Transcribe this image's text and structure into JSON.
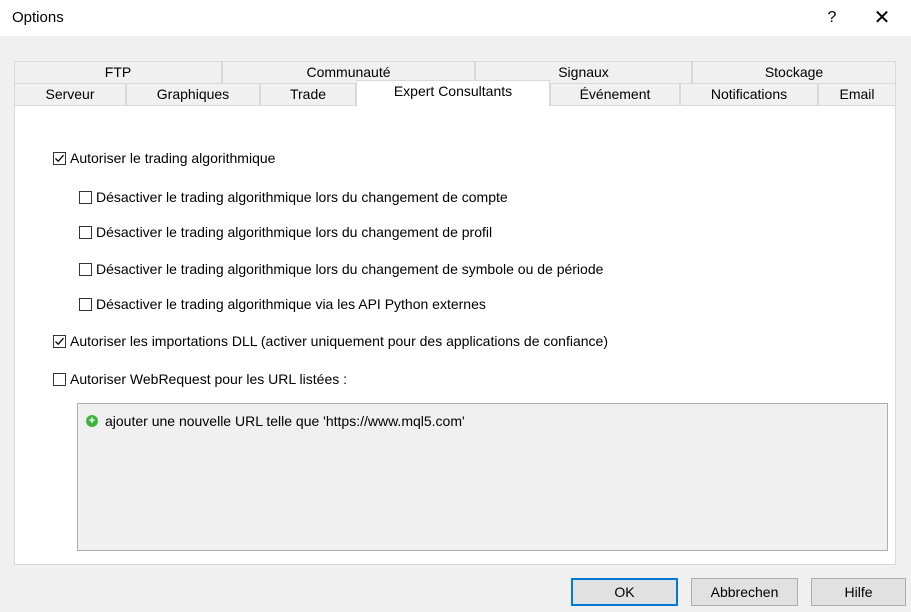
{
  "window": {
    "title": "Options",
    "help": "?",
    "close": "✕"
  },
  "tabs_back": [
    "FTP",
    "Communauté",
    "Signaux",
    "Stockage"
  ],
  "tabs_front": [
    "Serveur",
    "Graphiques",
    "Trade",
    "Expert Consultants",
    "Événement",
    "Notifications",
    "Email"
  ],
  "active_tab": "Expert Consultants",
  "options": {
    "allow_algo": {
      "label": "Autoriser le trading algorithmique",
      "checked": true
    },
    "disable_account": {
      "label": "Désactiver le trading algorithmique lors du changement de compte",
      "checked": false
    },
    "disable_profile": {
      "label": "Désactiver le trading algorithmique lors du changement de profil",
      "checked": false
    },
    "disable_symbol": {
      "label": "Désactiver le trading algorithmique lors du changement de symbole ou de période",
      "checked": false
    },
    "disable_python": {
      "label": "Désactiver le trading algorithmique via les API Python externes",
      "checked": false
    },
    "allow_dll": {
      "label": "Autoriser les importations DLL (activer uniquement pour des applications de confiance)",
      "checked": true
    },
    "allow_webrequest": {
      "label": "Autoriser WebRequest pour les URL listées :",
      "checked": false
    }
  },
  "url_list": {
    "add_item": "ajouter une nouvelle URL telle que 'https://www.mql5.com'"
  },
  "buttons": {
    "ok": "OK",
    "cancel": "Abbrechen",
    "help": "Hilfe"
  },
  "colors": {
    "focus": "#0078d7",
    "add_icon": "#3fb33f"
  }
}
